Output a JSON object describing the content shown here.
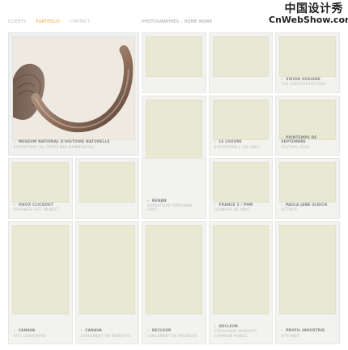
{
  "watermark": {
    "cn": "中国设计秀",
    "en": "CnWebShow.com"
  },
  "nav": {
    "items": [
      {
        "label": "CLIENTS"
      },
      {
        "label": "PORTFOLIO",
        "active": true
      },
      {
        "label": "CONTACT"
      }
    ]
  },
  "page_subtitle": "PHOTOGRAPHIES – HOME WORK",
  "colors": {
    "accent": "#f0a03a",
    "tile_placeholder": "#e9e9d3",
    "grid_bg": "#f2f2f0"
  },
  "icons": {
    "label_arrow": "chevron-right-icon"
  },
  "portfolio": {
    "items": [
      {
        "title": "MUSEUM NATIONAL D'HISTOIRE NATURELLE",
        "subtitle": "EXPOSITION \"AU TEMPS DES MAMMOUTHS\""
      },
      {
        "title": "",
        "subtitle": ""
      },
      {
        "title": "",
        "subtitle": ""
      },
      {
        "title": "VISION VOSGINE",
        "subtitle": "THE CREATIVE FACTORY"
      },
      {
        "title": "",
        "subtitle": ""
      },
      {
        "title": "LE LOUVRE",
        "subtitle": "EXPOSITION L. DE VINCI"
      },
      {
        "title": "PRINTEMPS DE SEPTEMBRE",
        "subtitle": "FESTIVAL 2006"
      },
      {
        "title": "VIEUX CLICQUOT",
        "subtitle": "BUSINESS GIFT PROJECT"
      },
      {
        "title": "",
        "subtitle": ""
      },
      {
        "title": "RENAN",
        "subtitle": "EXPOSITION YORKUNAN 2007"
      },
      {
        "title": "FRANCE 5 / PHM",
        "subtitle": "LEONARD DE VINCI"
      },
      {
        "title": "PAULA JANE ULRICH",
        "subtitle": "ACTRICE"
      },
      {
        "title": "CANAVA",
        "subtitle": "SITE CORPORATE"
      },
      {
        "title": "CANAVA",
        "subtitle": "LANCEMENT DE PRODUITS"
      },
      {
        "title": "DECLEOR",
        "subtitle": "LANCEMENT DE PRODUITS"
      },
      {
        "title": "DECLEOR",
        "subtitle": "CATALOGUE PRODUITS CAMPAGN PUBLIC"
      },
      {
        "title": "PROFIL INDUSTRIE",
        "subtitle": "SITE WEB"
      }
    ]
  }
}
